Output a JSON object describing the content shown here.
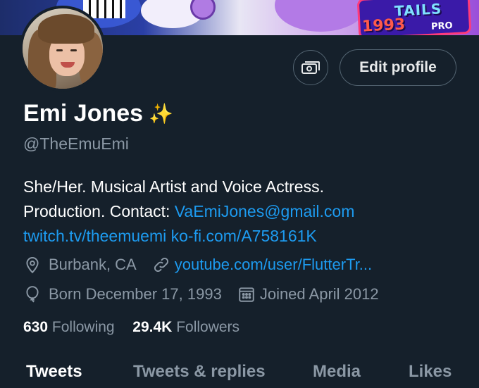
{
  "profile": {
    "name": "Emi Jones",
    "name_emoji": "✨",
    "handle": "@TheEmuEmi",
    "bio_line1": "She/Her. Musical Artist and Voice Actress.",
    "bio_line2_prefix": "Production. Contact: ",
    "bio_email": "VaEmiJones@gmail.com",
    "bio_link1": "twitch.tv/theemuemi",
    "bio_link2": "ko-fi.com/A758161K",
    "location": "Burbank, CA",
    "website": "youtube.com/user/FlutterTr...",
    "birthday": "Born December 17, 1993",
    "joined": "Joined April 2012",
    "following_count": "630",
    "following_label": "Following",
    "followers_count": "29.4K",
    "followers_label": "Followers"
  },
  "banner": {
    "logo_text": "TAILS",
    "logo_year": "1993",
    "logo_pro": "PRO"
  },
  "actions": {
    "edit_profile": "Edit profile"
  },
  "tabs": [
    {
      "label": "Tweets",
      "active": true
    },
    {
      "label": "Tweets & replies",
      "active": false
    },
    {
      "label": "Media",
      "active": false
    },
    {
      "label": "Likes",
      "active": false
    }
  ],
  "colors": {
    "background": "#15202b",
    "link": "#1d9bf0",
    "secondary_text": "#8b98a5",
    "border": "#536471"
  },
  "icons": {
    "location": "location-pin-icon",
    "website": "link-icon",
    "birthday": "balloon-icon",
    "joined": "calendar-icon",
    "tip": "money-icon"
  }
}
